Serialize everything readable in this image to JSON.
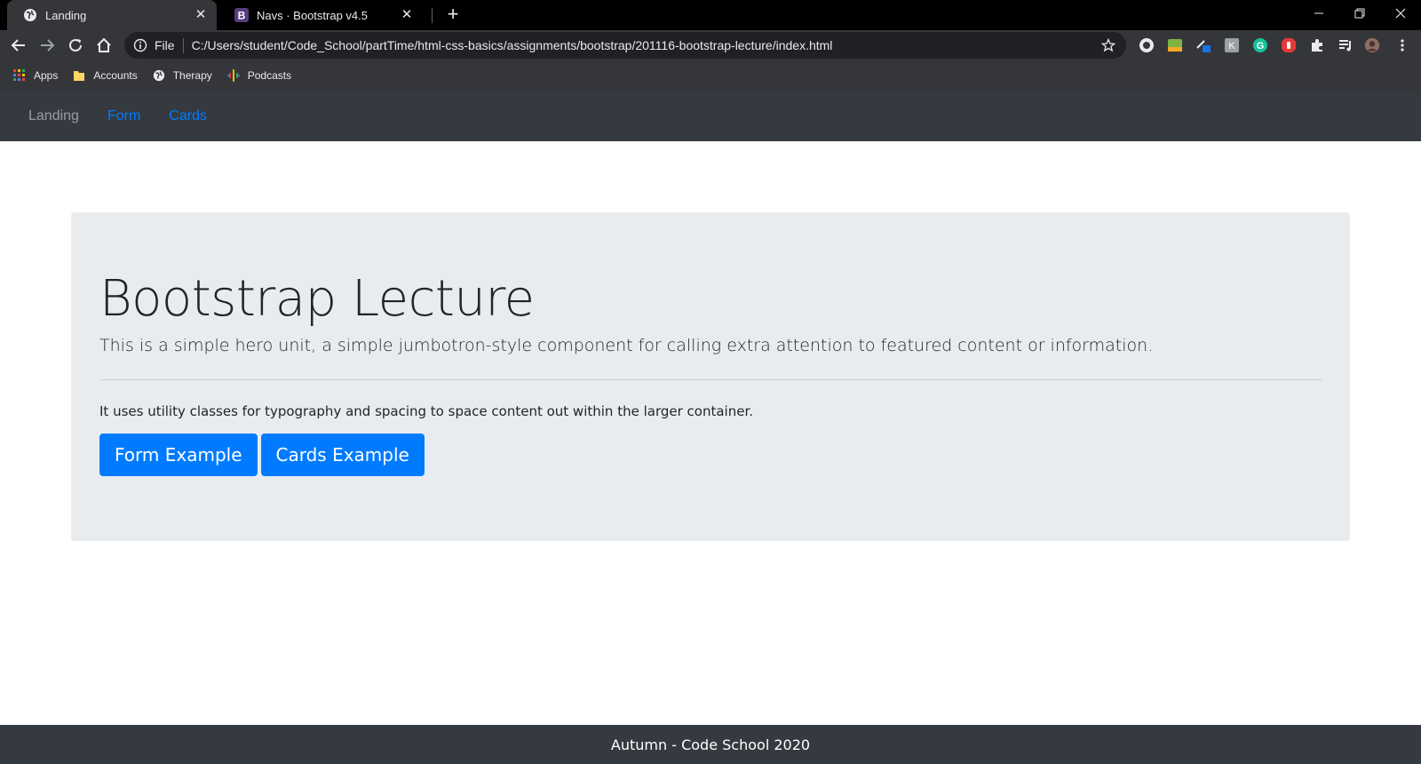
{
  "browser": {
    "tabs": [
      {
        "title": "Landing",
        "active": true,
        "icon": "globe-icon"
      },
      {
        "title": "Navs · Bootstrap v4.5",
        "active": false,
        "icon": "bootstrap-icon",
        "icon_letter": "B"
      }
    ],
    "address": {
      "scheme_label": "File",
      "url": "C:/Users/student/Code_School/partTime/html-css-basics/assignments/bootstrap/201116-bootstrap-lecture/index.html"
    },
    "bookmarks": [
      {
        "label": "Apps",
        "icon": "apps-grid-icon"
      },
      {
        "label": "Accounts",
        "icon": "folder-icon"
      },
      {
        "label": "Therapy",
        "icon": "globe-icon"
      },
      {
        "label": "Podcasts",
        "icon": "podcasts-icon"
      }
    ],
    "accent_colors": {
      "chrome_dark": "#35363a",
      "tab_strip": "#000000",
      "omnibox": "#202124"
    }
  },
  "page": {
    "nav": {
      "items": [
        {
          "label": "Landing",
          "style": "muted"
        },
        {
          "label": "Form",
          "style": "link"
        },
        {
          "label": "Cards",
          "style": "link"
        }
      ]
    },
    "hero": {
      "heading": "Bootstrap Lecture",
      "lead": "This is a simple hero unit, a simple jumbotron-style component for calling extra attention to featured content or information.",
      "body": "It uses utility classes for typography and spacing to space content out within the larger container.",
      "buttons": [
        {
          "label": "Form Example"
        },
        {
          "label": "Cards Example"
        }
      ]
    },
    "footer": {
      "text": "Autumn - Code School 2020"
    },
    "colors": {
      "primary": "#007bff",
      "dark": "#343a40",
      "jumbotron": "#e9ecef"
    }
  }
}
